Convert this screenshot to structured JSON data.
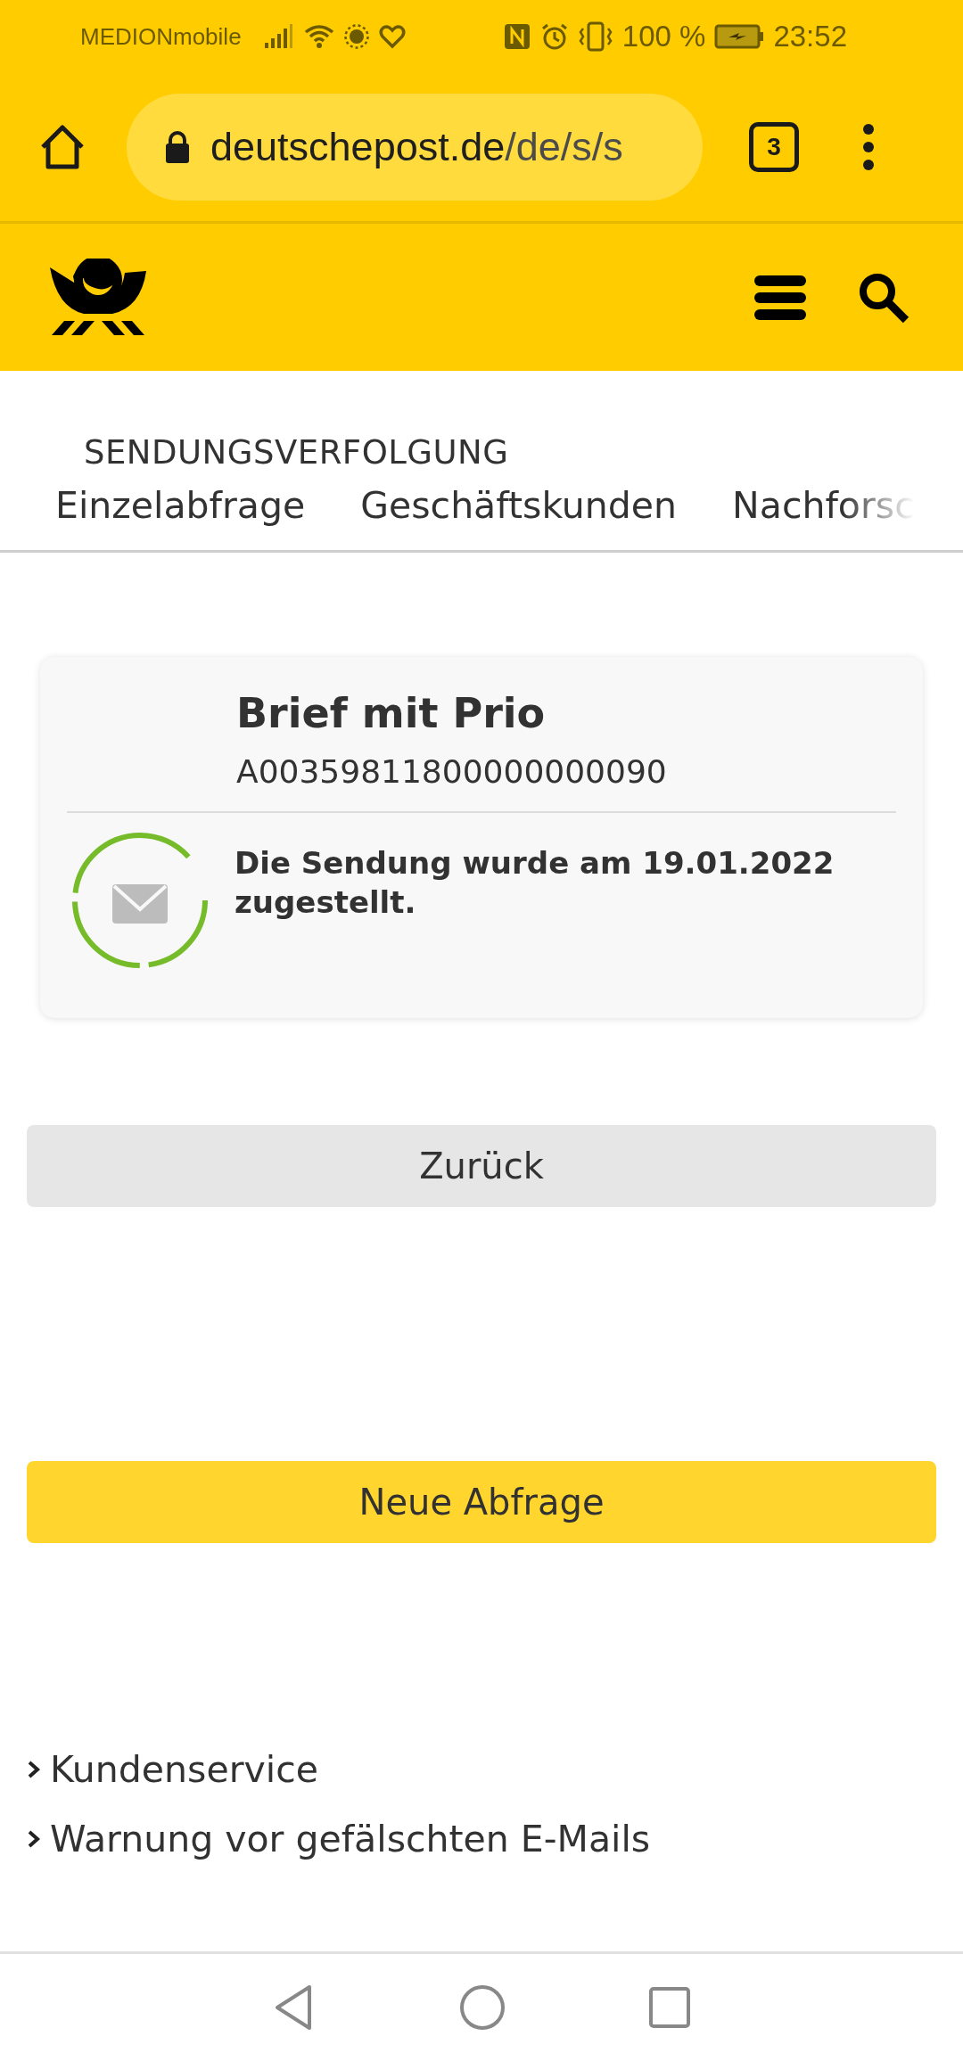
{
  "status_bar": {
    "carrier": "MEDIONmobile",
    "battery": "100 %",
    "time": "23:52"
  },
  "browser": {
    "url_domain": "deutschepost.de",
    "url_path": "/de/s/s",
    "tab_count": "3"
  },
  "section_title": "SENDUNGSVERFOLGUNG",
  "tabs": [
    {
      "label": "Einzelabfrage"
    },
    {
      "label": "Geschäftskunden"
    },
    {
      "label": "Nachforsc"
    }
  ],
  "shipment": {
    "title": "Brief mit Prio",
    "number": "A00359811800000000090",
    "status": "Die Sendung wurde am 19.01.2022 zugestellt."
  },
  "buttons": [
    {
      "label": "Zurück",
      "kind": "secondary"
    },
    {
      "label": "Neue Abfrage",
      "kind": "primary"
    }
  ],
  "links": [
    "Kundenservice",
    "Warnung vor gefälschten E-Mails"
  ]
}
